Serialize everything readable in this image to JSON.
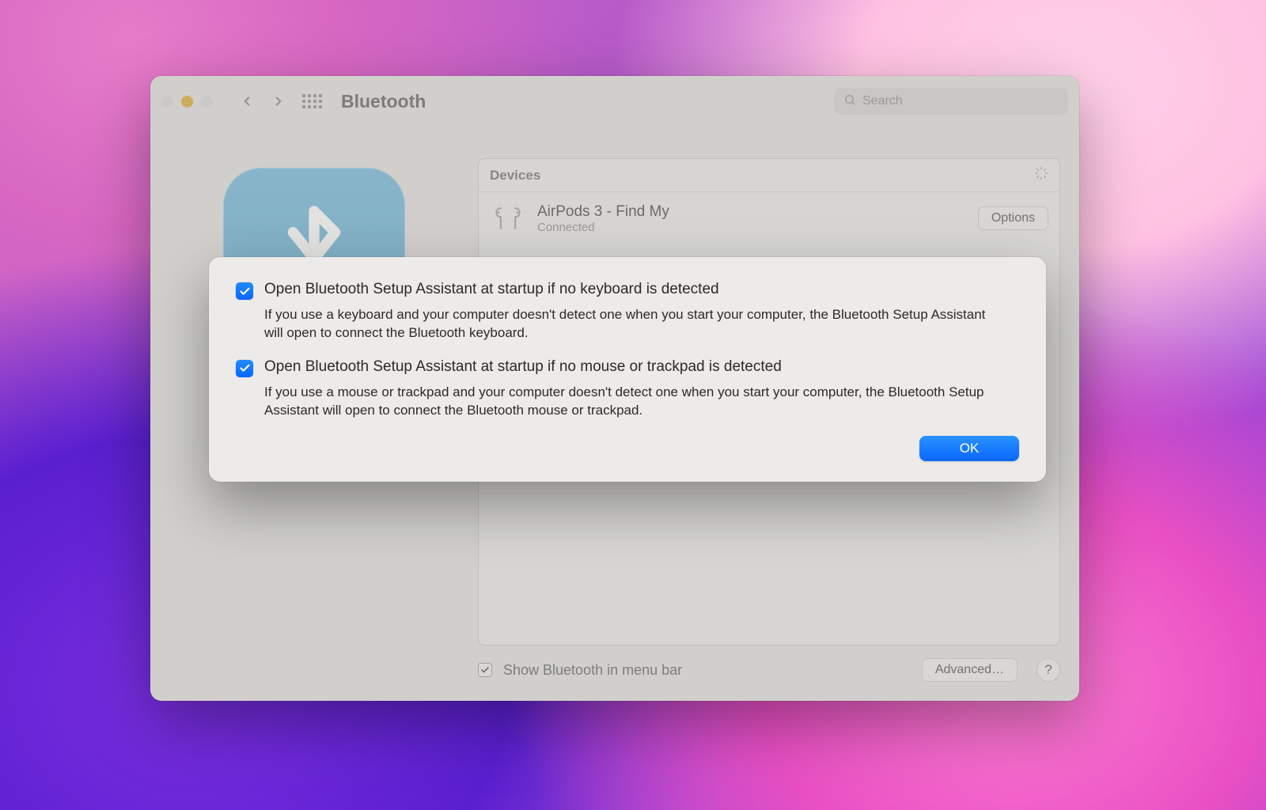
{
  "window": {
    "title": "Bluetooth",
    "search_placeholder": "Search"
  },
  "devices": {
    "header": "Devices",
    "items": [
      {
        "name": "AirPods 3 - Find My",
        "status": "Connected",
        "options_label": "Options"
      }
    ]
  },
  "footer": {
    "show_menu_bar_label": "Show Bluetooth in menu bar",
    "show_menu_bar_checked": true,
    "advanced_label": "Advanced…",
    "help_label": "?"
  },
  "sheet": {
    "options": [
      {
        "checked": true,
        "title": "Open Bluetooth Setup Assistant at startup if no keyboard is detected",
        "desc": "If you use a keyboard and your computer doesn't detect one when you start your computer, the Bluetooth Setup Assistant will open to connect the Bluetooth keyboard."
      },
      {
        "checked": true,
        "title": "Open Bluetooth Setup Assistant at startup if no mouse or trackpad is detected",
        "desc": "If you use a mouse or trackpad and your computer doesn't detect one when you start your computer, the Bluetooth Setup Assistant will open to connect the Bluetooth mouse or trackpad."
      }
    ],
    "ok_label": "OK"
  }
}
